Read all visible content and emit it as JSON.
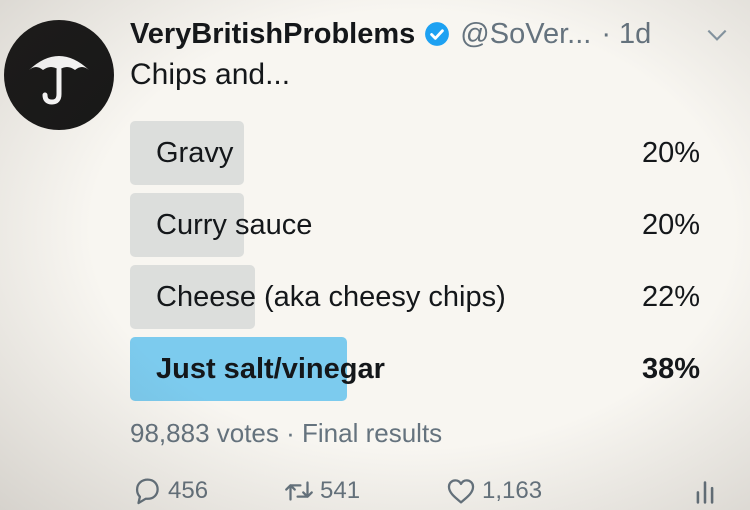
{
  "tweet": {
    "display_name": "VeryBritishProblems",
    "handle": "@SoVer...",
    "time": "· 1d",
    "text": "Chips and..."
  },
  "poll": {
    "options": [
      {
        "label": "Gravy",
        "percent": "20%",
        "fraction": 0.2
      },
      {
        "label": "Curry sauce",
        "percent": "20%",
        "fraction": 0.2
      },
      {
        "label": "Cheese (aka cheesy chips)",
        "percent": "22%",
        "fraction": 0.22
      },
      {
        "label": "Just salt/vinegar",
        "percent": "38%",
        "fraction": 0.38,
        "winner": true
      }
    ],
    "votes": "98,883 votes",
    "status": "· Final results"
  },
  "actions": {
    "replies": "456",
    "retweets": "541",
    "likes": "1,163"
  },
  "colors": {
    "winner_bar": "#7ccbee",
    "option_bar": "#dcdedc",
    "verified": "#1da1f2"
  },
  "icons": [
    "umbrella-logo-icon",
    "verified-badge-icon",
    "chevron-down-icon",
    "reply-icon",
    "retweet-icon",
    "like-icon",
    "analytics-icon"
  ]
}
